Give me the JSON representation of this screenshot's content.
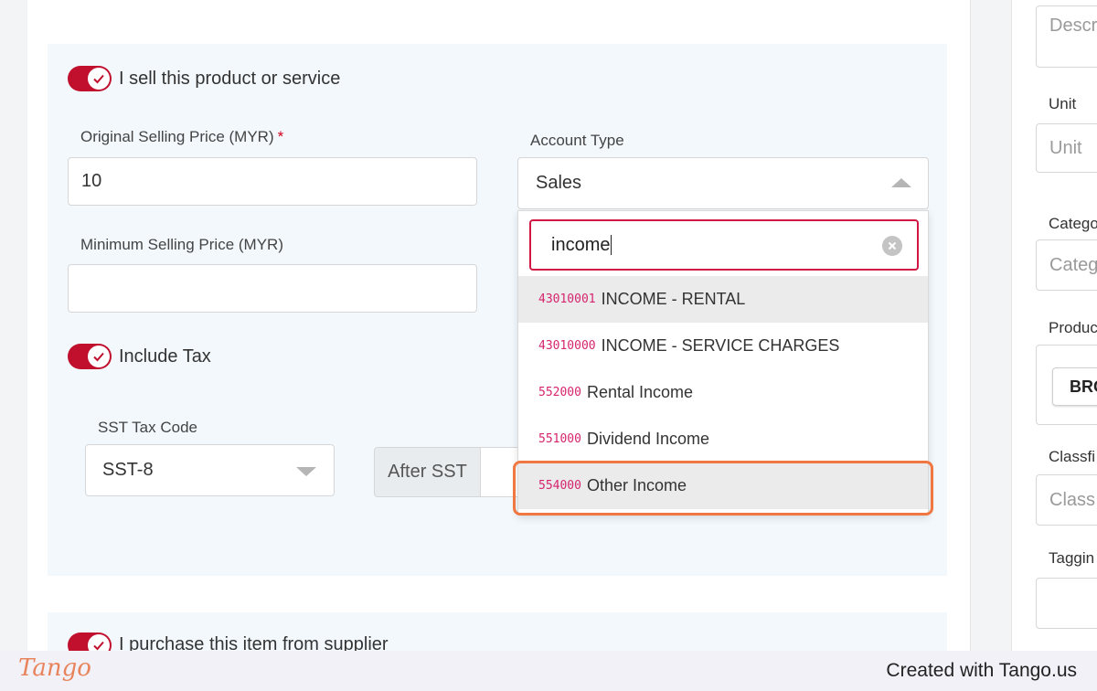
{
  "sell_section": {
    "toggle_label": "I sell this product or service",
    "original_price": {
      "label": "Original Selling Price (MYR)",
      "required_mark": "*",
      "value": "10"
    },
    "min_price": {
      "label": "Minimum Selling Price (MYR)",
      "value": ""
    },
    "account_type": {
      "label": "Account Type",
      "selected": "Sales"
    },
    "include_tax_label": "Include Tax",
    "sst_tax_code": {
      "label": "SST Tax Code",
      "selected": "SST-8"
    },
    "after_sst_label": "After SST"
  },
  "dropdown": {
    "search_value": "income",
    "options": [
      {
        "code": "43010001",
        "name": "INCOME - RENTAL"
      },
      {
        "code": "43010000",
        "name": "INCOME - SERVICE CHARGES"
      },
      {
        "code": "552000",
        "name": "Rental Income"
      },
      {
        "code": "551000",
        "name": "Dividend Income"
      },
      {
        "code": "554000",
        "name": "Other Income"
      }
    ]
  },
  "purchase_section": {
    "toggle_label": "I purchase this item from supplier"
  },
  "right_column": {
    "description_placeholder": "Descr",
    "unit_label": "Unit",
    "unit_placeholder": "Unit",
    "category_label": "Catego",
    "category_placeholder": "Categ",
    "product_label": "Produc",
    "product_button": "BRO",
    "classification_label": "Classfi",
    "classification_placeholder": "Class",
    "tagging_label": "Taggin"
  },
  "footer": {
    "logo": "Tango",
    "credit": "Created with Tango.us"
  },
  "colors": {
    "toggle": "#c10f2e",
    "search_border": "#d01843",
    "code_text": "#d6246e",
    "highlight": "#f07742"
  }
}
